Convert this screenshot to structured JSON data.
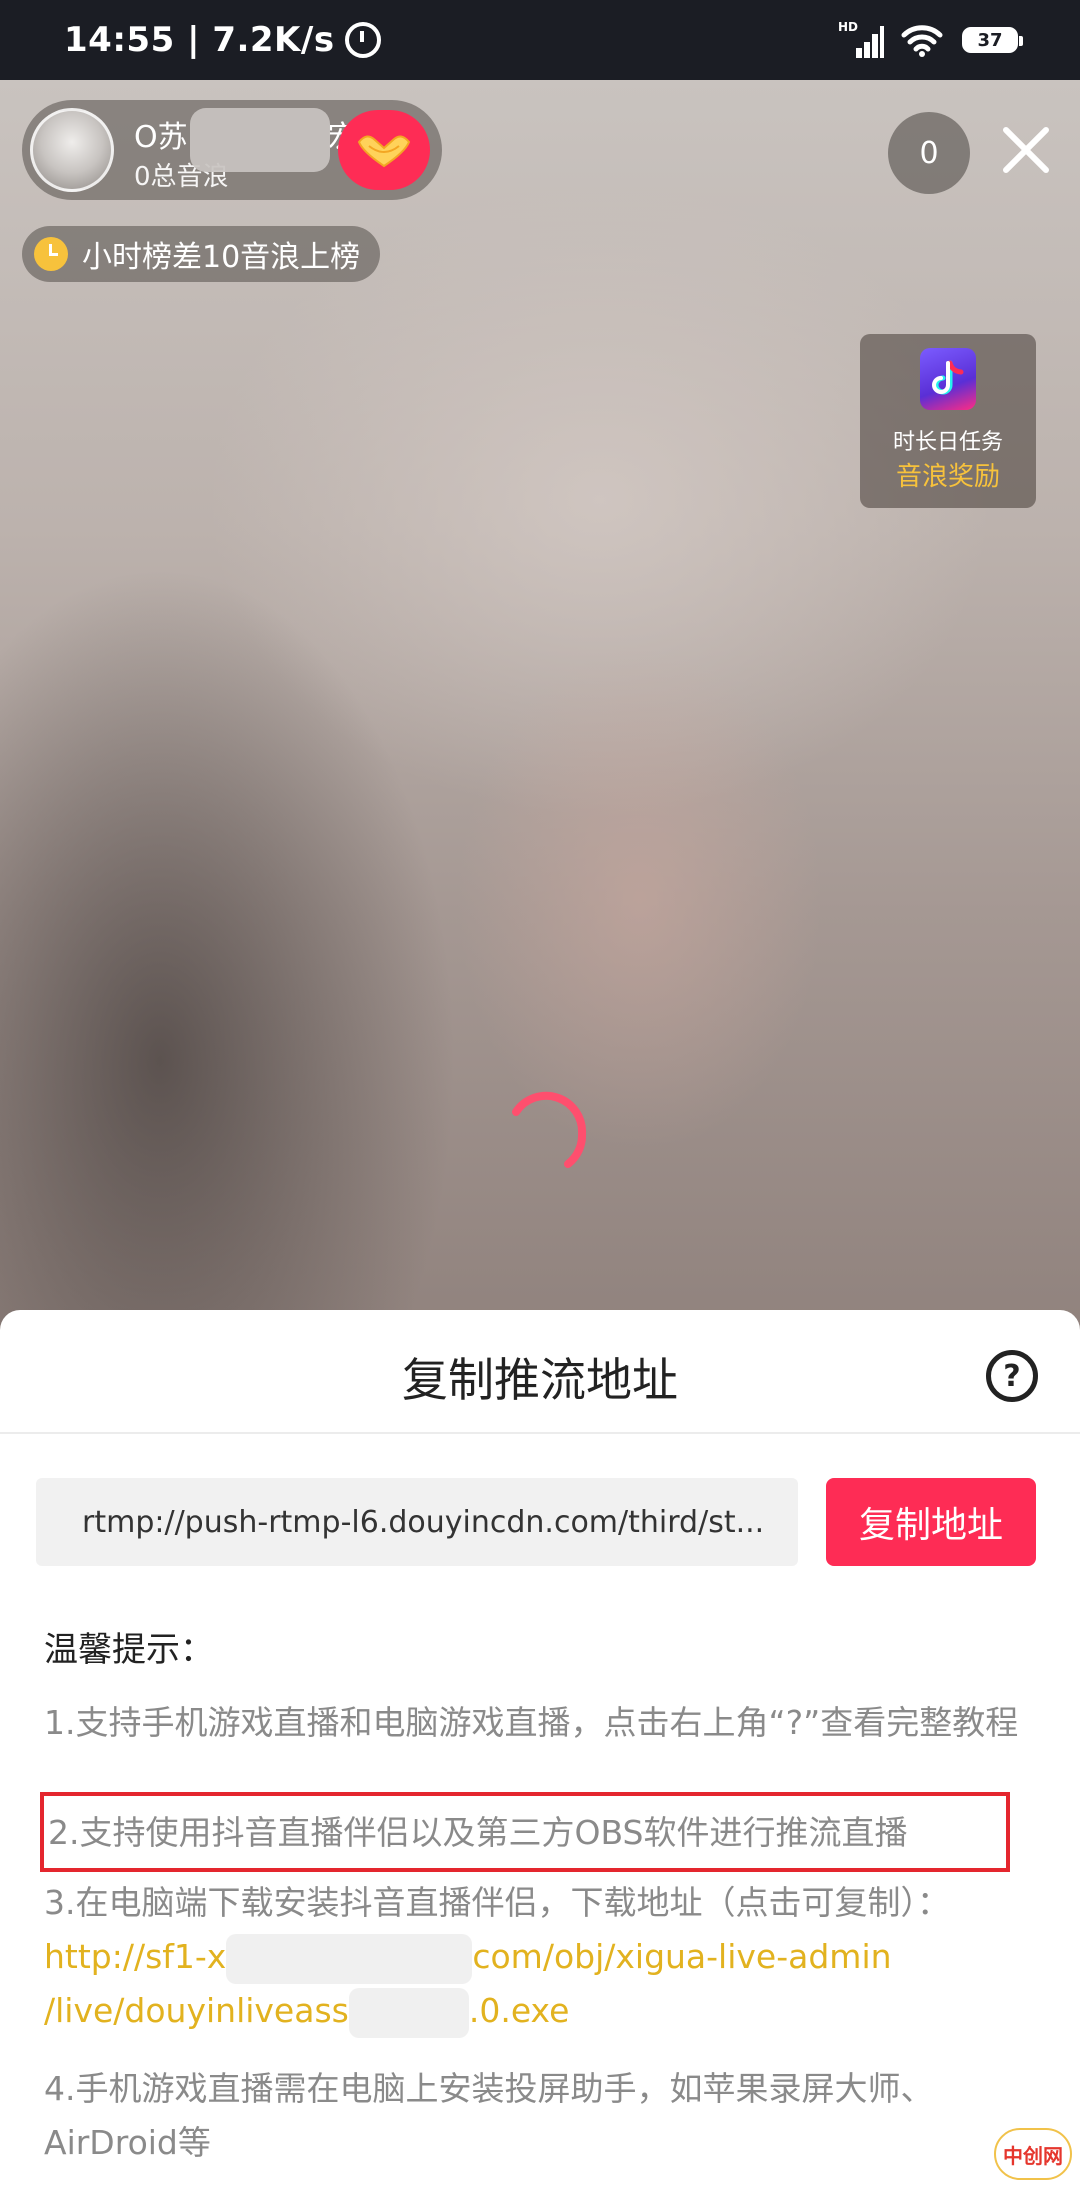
{
  "status_bar": {
    "time": "14:55",
    "speed": "7.2K/s",
    "network_type": "HD",
    "battery": "37"
  },
  "live_room": {
    "host_name": "O苏",
    "host_name_tail": "宏",
    "host_sub": "0总音浪",
    "viewer_count": "0",
    "rank_hint": "小时榜差10音浪上榜",
    "task_line1": "时长日任务",
    "task_line2": "音浪奖励"
  },
  "sheet": {
    "title": "复制推流地址",
    "help_label": "?",
    "url": "rtmp://push-rtmp-l6.douyincdn.com/third/st...",
    "copy_button": "复制地址",
    "tips_heading": "温馨提示：",
    "tips": [
      "1.支持手机游戏直播和电脑游戏直播，点击右上角“?”查看完整教程",
      "2.支持使用抖音直播伴侣以及第三方OBS软件进行推流直播",
      "3.在电脑端下载安装抖音直播伴侣，下载地址（点击可复制）：",
      "4.手机游戏直播需在电脑上安装投屏助手，如苹果录屏大师、AirDroid等"
    ],
    "tip3_link_part1": "http://sf1-x",
    "tip3_link_part2": "com/obj/xigua-live-admin",
    "tip3_link_part3": "/live/douyinliveass",
    "tip3_link_part4": ".0.exe"
  },
  "watermark": {
    "text": "中创网"
  },
  "colors": {
    "accent": "#fe2c55",
    "link": "#e2b21f",
    "highlight_box": "#e4262e",
    "gold": "#f7c23c"
  },
  "icons": {
    "status": [
      "alarm-icon",
      "signal-icon",
      "wifi-icon",
      "battery-icon"
    ],
    "live": [
      "host-avatar",
      "follow-heart-icon",
      "close-icon",
      "clock-icon",
      "douyin-task-icon",
      "loading-spinner"
    ],
    "sheet": [
      "help-icon"
    ]
  }
}
